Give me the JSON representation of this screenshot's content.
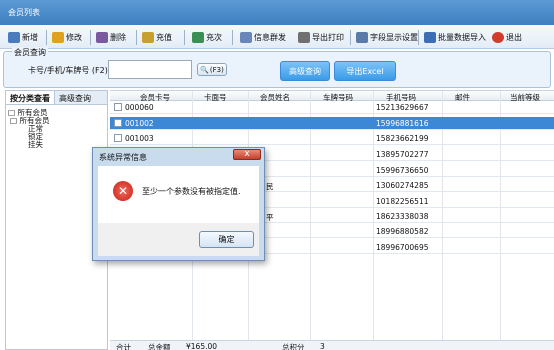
{
  "window": {
    "title": "会员列表"
  },
  "toolbar": {
    "buttons": [
      {
        "label": "新增",
        "icon": "add-icon",
        "color": "#4a7bbd"
      },
      {
        "label": "修改",
        "icon": "edit-icon",
        "color": "#e0a020"
      },
      {
        "label": "删除",
        "icon": "delete-icon",
        "color": "#7a5a9e"
      },
      {
        "label": "充值",
        "icon": "recharge-icon",
        "color": "#c8a030"
      },
      {
        "label": "充次",
        "icon": "recharge-times-icon",
        "color": "#3a8f55"
      },
      {
        "label": "信息群发",
        "icon": "message-icon",
        "color": "#6a86b8"
      },
      {
        "label": "导出打印",
        "icon": "print-icon",
        "color": "#707070"
      },
      {
        "label": "字段显示设置",
        "icon": "fields-icon",
        "color": "#5a7aa8"
      },
      {
        "label": "批量数据导入",
        "icon": "import-icon",
        "color": "#3c6eb4"
      },
      {
        "label": "退出",
        "icon": "exit-icon",
        "color": "#d23a2a"
      }
    ]
  },
  "query": {
    "legend": "会员查询",
    "label": "卡号/手机/车牌号 (F2):",
    "input_value": "",
    "f3_label": "(F3)",
    "advanced_label": "高级查询",
    "export_label": "导出Excel"
  },
  "left_panel": {
    "tabs": [
      "按分类查看",
      "高级查询"
    ],
    "tree": [
      "所有会员",
      "所有会员",
      "正常",
      "锁定",
      "挂失"
    ]
  },
  "grid": {
    "columns": [
      "会员卡号",
      "卡面号",
      "会员姓名",
      "车牌号码",
      "手机号码",
      "邮件",
      "当前等级"
    ],
    "rows": [
      {
        "card": "000060",
        "mid": "",
        "phone": "15213629667"
      },
      {
        "card": "001002",
        "mid": "",
        "phone": "15996881616"
      },
      {
        "card": "001003",
        "mid": "",
        "phone": "15823662199"
      },
      {
        "card": "",
        "mid": "",
        "phone": "13895702277"
      },
      {
        "card": "",
        "mid": "",
        "phone": "15996736650"
      },
      {
        "card": "",
        "mid": "民",
        "phone": "13060274285"
      },
      {
        "card": "",
        "mid": "",
        "phone": "10182256511"
      },
      {
        "card": "",
        "mid": "平",
        "phone": "18623338038"
      },
      {
        "card": "",
        "mid": "",
        "phone": "18996880582"
      },
      {
        "card": "",
        "mid": "",
        "phone": "18996700695"
      }
    ],
    "selected_index": 1
  },
  "footer": {
    "sum_label": "合计",
    "total_label": "总金额",
    "total_value": "¥165.00",
    "count_label": "总积分",
    "count_value": "3"
  },
  "dialog": {
    "title": "系统异常信息",
    "close": "x",
    "message": "至少一个参数没有被指定值.",
    "ok": "确定"
  },
  "colors": {
    "titlebar": "#4a8acb",
    "selected_row": "#3d88d6",
    "query_bg": "#eaf3fb"
  }
}
